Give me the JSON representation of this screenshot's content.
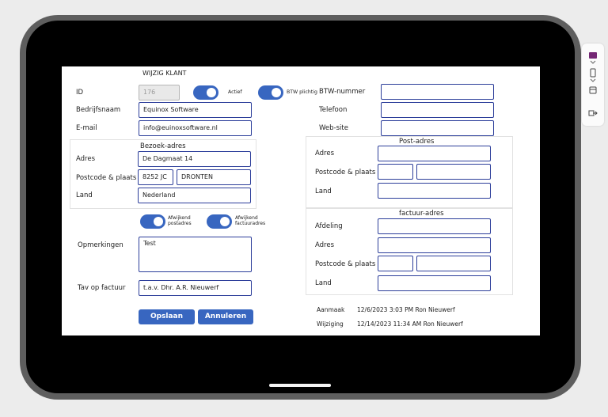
{
  "form": {
    "title": "WIJZIG KLANT",
    "id_label": "ID",
    "id_value": "176",
    "actief_label": "Actief",
    "btw_plichtig_label": "BTW plichtig",
    "btw_nummer_label": "BTW-nummer",
    "btw_nummer_value": "",
    "bedrijfsnaam_label": "Bedrijfsnaam",
    "bedrijfsnaam_value": "Equinox Software",
    "telefoon_label": "Telefoon",
    "telefoon_value": "",
    "email_label": "E-mail",
    "email_value": "info@euinoxsoftware.nl",
    "website_label": "Web-site",
    "website_value": "",
    "opmerkingen_label": "Opmerkingen",
    "opmerkingen_value": "Test",
    "tav_label": "Tav op factuur",
    "tav_value": "t.a.v. Dhr. A.R. Nieuwerf",
    "afwijkend_postadres_label": "Afwijkend postadres",
    "afwijkend_factuuradres_label": "Afwijkend factuuradres"
  },
  "bezoek": {
    "title": "Bezoek-adres",
    "adres_label": "Adres",
    "adres_value": "De Dagmaat 14",
    "postcode_label": "Postcode & plaats",
    "postcode_value": "8252 JC",
    "plaats_value": "DRONTEN",
    "land_label": "Land",
    "land_value": "Nederland"
  },
  "post": {
    "title": "Post-adres",
    "adres_label": "Adres",
    "postcode_label": "Postcode & plaats",
    "land_label": "Land"
  },
  "factuur": {
    "title": "factuur-adres",
    "afdeling_label": "Afdeling",
    "adres_label": "Adres",
    "postcode_label": "Postcode & plaats",
    "land_label": "Land"
  },
  "meta": {
    "aanmaak_label": "Aanmaak",
    "aanmaak_value": "12/6/2023 3:03 PM Ron Nieuwerf",
    "wijziging_label": "Wijziging",
    "wijziging_value": "12/14/2023 11:34 AM Ron Nieuwerf"
  },
  "buttons": {
    "opslaan": "Opslaan",
    "annuleren": "Annuleren"
  },
  "toggles": {
    "actief": true,
    "btw_plichtig": true,
    "afwijkend_postadres": true,
    "afwijkend_factuuradres": true
  },
  "colors": {
    "accent": "#3866c0",
    "input_border": "#2c3e9a",
    "device_frame": "#5e5e5e"
  },
  "sidebar": {
    "icons": [
      "app-icon",
      "phone-icon",
      "panel-icon",
      "exit-icon"
    ]
  }
}
